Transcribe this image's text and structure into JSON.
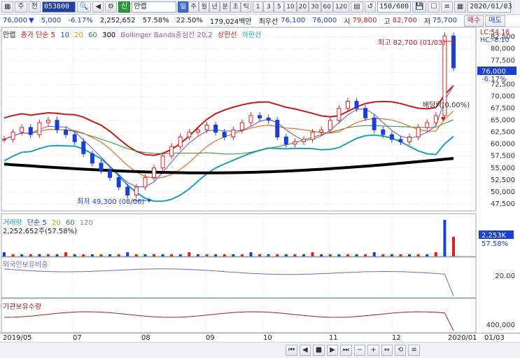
{
  "toolbar": {
    "icon1": "chart-icon",
    "mode_label": "주",
    "all_label": "전",
    "code_value": "053800",
    "search_icon": "search-icon",
    "name_badge": "신",
    "stock_name": "안랩",
    "period_buttons": [
      "일",
      "주",
      "월",
      "년",
      "분",
      "초",
      "틱"
    ],
    "selected_period": "일",
    "number_buttons": [
      "1",
      "3",
      "5",
      "10",
      "20",
      "30",
      "60",
      "120"
    ],
    "count_value": "150",
    "count_total": "600",
    "date_value": "2020/01/03"
  },
  "quote": {
    "price": "76,000",
    "change": "5,000",
    "change_pct": "-6.17%",
    "volume": "2,252,652",
    "ratio1": "57.58%",
    "ratio2": "22.50%",
    "amount": "179,024백만",
    "best_ask_label": "최우선",
    "best_ask": "76,100",
    "best_bid": "76,000",
    "open_label": "시",
    "open": "79,800",
    "high_label": "고",
    "high": "82,700",
    "low_label": "저",
    "low": "75,700",
    "buy_label": "매수",
    "sell_label": "매도"
  },
  "price_panel": {
    "legend": {
      "name": "안랩",
      "ma_label": "종가 단순 5",
      "ma10": "10",
      "ma20": "20",
      "ma60": "60",
      "ma300": "300",
      "bb_label": "Bollinger Bands중심선 20,2",
      "upper_label": "상한선",
      "lower_label": "하한선"
    },
    "lc_label": "LC:54.16",
    "hc_label": "HC:-8.10",
    "high_annotation": "최고 82,700 (01/03)",
    "low_annotation": "최저 49,300 (08/06)",
    "dividend_annotation": "배당락(0.00%)",
    "current_price_tag": "76,000",
    "current_pct_tag": "-6.17%",
    "y_ticks": [
      "82,500",
      "80,000",
      "77,500",
      "75,000",
      "72,500",
      "70,000",
      "67,500",
      "65,000",
      "62,500",
      "60,000",
      "57,500",
      "55,000",
      "52,500",
      "50,000",
      "47,500"
    ]
  },
  "volume_panel": {
    "legend_name": "거래량",
    "legend_ma": "단순 5",
    "ma20": "20",
    "ma60": "60",
    "ma120": "120",
    "value_line": "2,252,652주(57.58%)",
    "tag_value": "2,253K",
    "tag_pct": "57.58%"
  },
  "foreign_panel": {
    "legend": "외국인보유비중",
    "tick": "20.00"
  },
  "inst_panel": {
    "legend": "기관보유수량",
    "tick": "400,000"
  },
  "x_axis": {
    "labels": [
      "2019/05",
      "07",
      "08",
      "09",
      "10",
      "11",
      "12",
      "2020/01"
    ],
    "right_label": "01/03"
  },
  "colors": {
    "up": "#e02020",
    "down": "#1a3fd6",
    "bb_upper": "#c81818",
    "bb_lower": "#1aa0b8",
    "ma300": "#000000",
    "ma20": "#e07020",
    "ma60": "#2e8b3a",
    "volume_up": "#e02020",
    "foreign_line": "#6a6ac8",
    "inst_line": "#a02020"
  },
  "chart_data": {
    "type": "line",
    "title": "",
    "ylim": [
      47500,
      82700
    ],
    "series": [
      {
        "name": "Price (close)",
        "values": [
          61000,
          62500,
          63500,
          62000,
          64500,
          65000,
          63000,
          62000,
          60500,
          58000,
          56000,
          54500,
          53000,
          51000,
          49300,
          51000,
          53000,
          55000,
          57500,
          59500,
          61500,
          62500,
          63000,
          64000,
          62500,
          61500,
          63000,
          64500,
          66000,
          65500,
          65000,
          61500,
          60000,
          60500,
          61000,
          62500,
          63000,
          65000,
          67500,
          69000,
          67500,
          65500,
          63000,
          62000,
          61000,
          60500,
          61500,
          63500,
          64500,
          66000,
          82700,
          76000
        ]
      }
    ],
    "annotations": {
      "high": {
        "label": "최고 82,700 (01/03)",
        "value": 82700
      },
      "low": {
        "label": "최저 49,300 (08/06)",
        "value": 49300
      }
    }
  }
}
